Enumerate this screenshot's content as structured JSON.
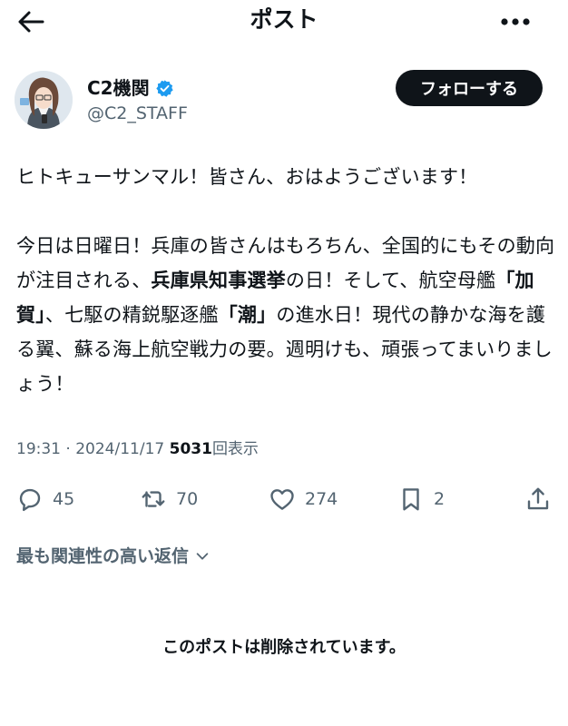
{
  "header": {
    "title": "ポスト",
    "back_icon": "arrow-left-icon",
    "more_icon": "more-dots-icon"
  },
  "author": {
    "display_name": "C2機関",
    "handle": "@C2_STAFF",
    "verified_color": "#1d9bf0",
    "follow_label": "フォローする"
  },
  "tweet": {
    "line1": "ヒトキューサンマル！皆さん、おはようございます！",
    "p2_a": "今日は日曜日！兵庫の皆さんはもろちん、全国的にもその動向が注目される、",
    "p2_b": "兵庫県知事選挙",
    "p2_c": "の日！そして、航空母艦",
    "p2_d": "「加賀」",
    "p2_e": "、七駆の精鋭駆逐艦",
    "p2_f": "「潮」",
    "p2_g": "の進水日！現代の静かな海を護る翼、蘇る海上航空戦力の要。週明けも、頑張ってまいりましょう！"
  },
  "meta": {
    "time": "19:31",
    "separator": " · ",
    "date": "2024/11/17",
    "views_count": "5031",
    "views_label": "回表示"
  },
  "actions": {
    "replies": "45",
    "reposts": "70",
    "likes": "274",
    "bookmarks": "2"
  },
  "replies_sort": {
    "label": "最も関連性の高い返信"
  },
  "deleted_notice": "このポストは削除されています。"
}
